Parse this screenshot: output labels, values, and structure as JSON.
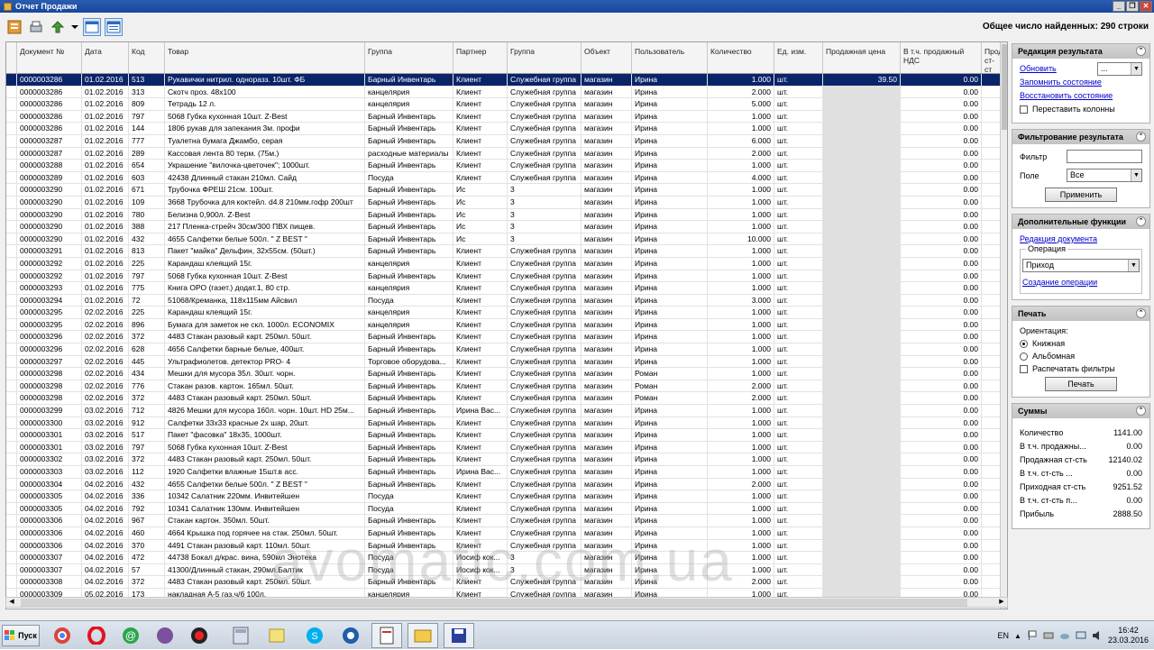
{
  "window": {
    "title": "Отчет Продажи",
    "found_label": "Общее число найденных: 290 строки"
  },
  "toolbar": {
    "icons": [
      "report-icon",
      "print-preview-icon",
      "export-icon",
      "dropdown-arrow-icon",
      "window-icon",
      "layout-icon"
    ]
  },
  "table": {
    "columns": [
      "Документ №",
      "Дата",
      "Код",
      "Товар",
      "Группа",
      "Партнер",
      "Группа",
      "Объект",
      "Пользователь",
      "Количество",
      "Ед. изм.",
      "Продажная цена",
      "В т.ч. продажный НДС",
      "Прод ст-ст"
    ],
    "rows": [
      [
        "0000003286",
        "01.02.2016",
        "513",
        "Рукавички нитрил. одноразз. 10шт. ФБ",
        "Барный Инвентарь",
        "Клиент",
        "Служебная группа",
        "магазин",
        "Ирина",
        "1.000",
        "шт.",
        "39.50",
        "0.00",
        ""
      ],
      [
        "0000003286",
        "01.02.2016",
        "313",
        "Скотч проз. 48х100",
        "канцелярия",
        "Клиент",
        "Служебная группа",
        "магазин",
        "Ирина",
        "2.000",
        "шт.",
        "",
        "0.00",
        ""
      ],
      [
        "0000003286",
        "01.02.2016",
        "809",
        "Тетрадь 12 л.",
        "канцелярия",
        "Клиент",
        "Служебная группа",
        "магазин",
        "Ирина",
        "5.000",
        "шт.",
        "",
        "0.00",
        ""
      ],
      [
        "0000003286",
        "01.02.2016",
        "797",
        "5068 Губка кухонная 10шт.  Z-Best",
        "Барный Инвентарь",
        "Клиент",
        "Служебная группа",
        "магазин",
        "Ирина",
        "1.000",
        "шт.",
        "",
        "0.00",
        ""
      ],
      [
        "0000003286",
        "01.02.2016",
        "144",
        "1806 рукав для запекания  3м. профи",
        "Барный Инвентарь",
        "Клиент",
        "Служебная группа",
        "магазин",
        "Ирина",
        "1.000",
        "шт.",
        "",
        "0.00",
        ""
      ],
      [
        "0000003287",
        "01.02.2016",
        "777",
        "Туалетна бумага Джамбо, серая",
        "Барный Инвентарь",
        "Клиент",
        "Служебная группа",
        "магазин",
        "Ирина",
        "6.000",
        "шт.",
        "",
        "0.00",
        ""
      ],
      [
        "0000003287",
        "01.02.2016",
        "289",
        "Кассовая лента 80 терм. (75м.)",
        "расходные материалы",
        "Клиент",
        "Служебная группа",
        "магазин",
        "Ирина",
        "2.000",
        "шт.",
        "",
        "0.00",
        ""
      ],
      [
        "0000003288",
        "01.02.2016",
        "654",
        "Украшение \"вилочка-цветочек\"; 1000шт.",
        "Барный Инвентарь",
        "Клиент",
        "Служебная группа",
        "магазин",
        "Ирина",
        "1.000",
        "шт.",
        "",
        "0.00",
        ""
      ],
      [
        "0000003289",
        "01.02.2016",
        "603",
        "42438 Длинный стакан 210мл. Сайд",
        "Посуда",
        "Клиент",
        "Служебная группа",
        "магазин",
        "Ирина",
        "4.000",
        "шт.",
        "",
        "0.00",
        ""
      ],
      [
        "0000003290",
        "01.02.2016",
        "671",
        "Трубочка ФРЕШ 21см.  100шт.",
        "Барный Инвентарь",
        "Ис",
        "3",
        "магазин",
        "Ирина",
        "1.000",
        "шт.",
        "",
        "0.00",
        ""
      ],
      [
        "0000003290",
        "01.02.2016",
        "109",
        "3668 Трубочка для коктейл. d4.8 210мм.гофр 200шт",
        "Барный Инвентарь",
        "Ис",
        "3",
        "магазин",
        "Ирина",
        "1.000",
        "шт.",
        "",
        "0.00",
        ""
      ],
      [
        "0000003290",
        "01.02.2016",
        "780",
        "Белизна 0,900л. Z-Best",
        "Барный Инвентарь",
        "Ис",
        "3",
        "магазин",
        "Ирина",
        "1.000",
        "шт.",
        "",
        "0.00",
        ""
      ],
      [
        "0000003290",
        "01.02.2016",
        "388",
        "217 Пленка-стрейч 30см/300 ПВХ пищев.",
        "Барный Инвентарь",
        "Ис",
        "3",
        "магазин",
        "Ирина",
        "1.000",
        "шт.",
        "",
        "0.00",
        ""
      ],
      [
        "0000003290",
        "01.02.2016",
        "432",
        "4655 Салфетки белые 500л. \" Z BEST \"",
        "Барный Инвентарь",
        "Ис",
        "3",
        "магазин",
        "Ирина",
        "10.000",
        "шт.",
        "",
        "0.00",
        ""
      ],
      [
        "0000003291",
        "01.02.2016",
        "813",
        "Пакет \"майка\" Дельфин, 32х55см.  (50шт.)",
        "Барный Инвентарь",
        "Клиент",
        "Служебная группа",
        "магазин",
        "Ирина",
        "1.000",
        "шт.",
        "",
        "0.00",
        ""
      ],
      [
        "0000003292",
        "01.02.2016",
        "225",
        "Карандаш клеящий 15г.",
        "канцелярия",
        "Клиент",
        "Служебная группа",
        "магазин",
        "Ирина",
        "1.000",
        "шт.",
        "",
        "0.00",
        ""
      ],
      [
        "0000003292",
        "01.02.2016",
        "797",
        "5068 Губка кухонная 10шт.  Z-Best",
        "Барный Инвентарь",
        "Клиент",
        "Служебная группа",
        "магазин",
        "Ирина",
        "1.000",
        "шт.",
        "",
        "0.00",
        ""
      ],
      [
        "0000003293",
        "01.02.2016",
        "775",
        "Книга ОРО (газет.) додат.1,  80 стр.",
        "канцелярия",
        "Клиент",
        "Служебная группа",
        "магазин",
        "Ирина",
        "1.000",
        "шт.",
        "",
        "0.00",
        ""
      ],
      [
        "0000003294",
        "01.02.2016",
        "72",
        "51068/Креманка, 118х115мм Айсвил",
        "Посуда",
        "Клиент",
        "Служебная группа",
        "магазин",
        "Ирина",
        "3.000",
        "шт.",
        "",
        "0.00",
        ""
      ],
      [
        "0000003295",
        "02.02.2016",
        "225",
        "Карандаш клеящий 15г.",
        "канцелярия",
        "Клиент",
        "Служебная группа",
        "магазин",
        "Ирина",
        "1.000",
        "шт.",
        "",
        "0.00",
        ""
      ],
      [
        "0000003295",
        "02.02.2016",
        "896",
        "Бумага для заметок не скл. 1000л. ECONOMIX",
        "канцелярия",
        "Клиент",
        "Служебная группа",
        "магазин",
        "Ирина",
        "1.000",
        "шт.",
        "",
        "0.00",
        ""
      ],
      [
        "0000003296",
        "02.02.2016",
        "372",
        "4483 Стакан разовый карт.   250мл. 50шт.",
        "Барный Инвентарь",
        "Клиент",
        "Служебная группа",
        "магазин",
        "Ирина",
        "1.000",
        "шт.",
        "",
        "0.00",
        ""
      ],
      [
        "0000003296",
        "02.02.2016",
        "628",
        "4656 Салфетки барные белые, 400шт.",
        "Барный Инвентарь",
        "Клиент",
        "Служебная группа",
        "магазин",
        "Ирина",
        "1.000",
        "шт.",
        "",
        "0.00",
        ""
      ],
      [
        "0000003297",
        "02.02.2016",
        "445",
        "Ультрафиолетов. детектор PRO- 4",
        "Торговое оборудова...",
        "Клиент",
        "Служебная группа",
        "магазин",
        "Ирина",
        "1.000",
        "шт.",
        "",
        "0.00",
        ""
      ],
      [
        "0000003298",
        "02.02.2016",
        "434",
        "Мешки для мусора 35л. 30шт. чорн.",
        "Барный Инвентарь",
        "Клиент",
        "Служебная группа",
        "магазин",
        "Роман",
        "1.000",
        "шт.",
        "",
        "0.00",
        ""
      ],
      [
        "0000003298",
        "02.02.2016",
        "776",
        "Стакан разов. картон.  165мл.  50шт.",
        "Барный Инвентарь",
        "Клиент",
        "Служебная группа",
        "магазин",
        "Роман",
        "2.000",
        "шт.",
        "",
        "0.00",
        ""
      ],
      [
        "0000003298",
        "02.02.2016",
        "372",
        "4483 Стакан разовый карт.   250мл. 50шт.",
        "Барный Инвентарь",
        "Клиент",
        "Служебная группа",
        "магазин",
        "Роман",
        "2.000",
        "шт.",
        "",
        "0.00",
        ""
      ],
      [
        "0000003299",
        "03.02.2016",
        "712",
        "4826 Мешки для мусора 160л. чорн.  10шт. HD 25м...",
        "Барный Инвентарь",
        "Ирина Вас...",
        "Служебная группа",
        "магазин",
        "Ирина",
        "1.000",
        "шт.",
        "",
        "0.00",
        ""
      ],
      [
        "0000003300",
        "03.02.2016",
        "912",
        "Салфетки 33х33 красные 2х шар, 20шт.",
        "Барный Инвентарь",
        "Клиент",
        "Служебная группа",
        "магазин",
        "Ирина",
        "1.000",
        "шт.",
        "",
        "0.00",
        ""
      ],
      [
        "0000003301",
        "03.02.2016",
        "517",
        "Пакет \"фасовка\" 18х35,  1000шт.",
        "Барный Инвентарь",
        "Клиент",
        "Служебная группа",
        "магазин",
        "Ирина",
        "1.000",
        "шт.",
        "",
        "0.00",
        ""
      ],
      [
        "0000003301",
        "03.02.2016",
        "797",
        "5068 Губка кухонная 10шт.  Z-Best",
        "Барный Инвентарь",
        "Клиент",
        "Служебная группа",
        "магазин",
        "Ирина",
        "1.000",
        "шт.",
        "",
        "0.00",
        ""
      ],
      [
        "0000003302",
        "03.02.2016",
        "372",
        "4483 Стакан разовый карт.   250мл. 50шт.",
        "Барный Инвентарь",
        "Клиент",
        "Служебная группа",
        "магазин",
        "Ирина",
        "1.000",
        "шт.",
        "",
        "0.00",
        ""
      ],
      [
        "0000003303",
        "03.02.2016",
        "112",
        "1920 Салфетки влажные 15шт.в асс.",
        "Барный Инвентарь",
        "Ирина Вас...",
        "Служебная группа",
        "магазин",
        "Ирина",
        "1.000",
        "шт.",
        "",
        "0.00",
        ""
      ],
      [
        "0000003304",
        "04.02.2016",
        "432",
        "4655 Салфетки белые 500л. \" Z BEST \"",
        "Барный Инвентарь",
        "Клиент",
        "Служебная группа",
        "магазин",
        "Ирина",
        "2.000",
        "шт.",
        "",
        "0.00",
        ""
      ],
      [
        "0000003305",
        "04.02.2016",
        "336",
        "10342 Салатник 220мм. Инвитейшен",
        "Посуда",
        "Клиент",
        "Служебная группа",
        "магазин",
        "Ирина",
        "1.000",
        "шт.",
        "",
        "0.00",
        ""
      ],
      [
        "0000003305",
        "04.02.2016",
        "792",
        "10341 Салатник 130мм.  Инвитейшен",
        "Посуда",
        "Клиент",
        "Служебная группа",
        "магазин",
        "Ирина",
        "1.000",
        "шт.",
        "",
        "0.00",
        ""
      ],
      [
        "0000003306",
        "04.02.2016",
        "967",
        "Стакан картон. 350мл.  50шт.",
        "Барный Инвентарь",
        "Клиент",
        "Служебная группа",
        "магазин",
        "Ирина",
        "1.000",
        "шт.",
        "",
        "0.00",
        ""
      ],
      [
        "0000003306",
        "04.02.2016",
        "460",
        "4664 Крышка под горячее на стак. 250мл. 50шт.",
        "Барный Инвентарь",
        "Клиент",
        "Служебная группа",
        "магазин",
        "Ирина",
        "1.000",
        "шт.",
        "",
        "0.00",
        ""
      ],
      [
        "0000003306",
        "04.02.2016",
        "370",
        "4491 Стакан разовый карт. 110мл. 50шт.",
        "Барный Инвентарь",
        "Клиент",
        "Служебная группа",
        "магазин",
        "Ирина",
        "1.000",
        "шт.",
        "",
        "0.00",
        ""
      ],
      [
        "0000003307",
        "04.02.2016",
        "472",
        "44738 Бокал д/крас. вина, 590мл Энотека",
        "Посуда",
        "Иосиф кок...",
        "3",
        "магазин",
        "Ирина",
        "1.000",
        "шт.",
        "",
        "0.00",
        ""
      ],
      [
        "0000003307",
        "04.02.2016",
        "57",
        "41300/Длинный стакан, 290мл.Балтик",
        "Посуда",
        "Иосиф кок...",
        "3",
        "магазин",
        "Ирина",
        "1.000",
        "шт.",
        "",
        "0.00",
        ""
      ],
      [
        "0000003308",
        "04.02.2016",
        "372",
        "4483 Стакан разовый карт.   250мл. 50шт.",
        "Барный Инвентарь",
        "Клиент",
        "Служебная группа",
        "магазин",
        "Ирина",
        "2.000",
        "шт.",
        "",
        "0.00",
        ""
      ],
      [
        "0000003309",
        "05.02.2016",
        "173",
        "накладная А-5 газ.ч/б 100л.",
        "канцелярия",
        "Клиент",
        "Служебная группа",
        "магазин",
        "Ирина",
        "1.000",
        "шт.",
        "",
        "0.00",
        ""
      ]
    ]
  },
  "sidebar": {
    "edit_panel": {
      "title": "Редакция результата",
      "refresh_link": "Обновить",
      "refresh_select": "...",
      "save_state_link": "Запомнить состояние",
      "restore_state_link": "Восстановить состояние",
      "rearrange_columns_label": "Переставить колонны"
    },
    "filter_panel": {
      "title": "Фильтрование результата",
      "filter_label": "Фильтр",
      "filter_value": "",
      "field_label": "Поле",
      "field_value": "Все",
      "apply_button": "Применить"
    },
    "functions_panel": {
      "title": "Дополнительные функции",
      "edit_document_link": "Редакция документа",
      "operation_label": "Операция",
      "operation_value": "Приход",
      "create_operation_link": "Создание операции"
    },
    "print_panel": {
      "title": "Печать",
      "orientation_label": "Ориентация:",
      "portrait_label": "Книжная",
      "landscape_label": "Альбомная",
      "print_filters_label": "Распечатать фильтры",
      "print_button": "Печать"
    },
    "sums_panel": {
      "title": "Суммы",
      "rows": [
        {
          "label": "Количество",
          "value": "1141.00"
        },
        {
          "label": "В т.ч. продажны...",
          "value": "0.00"
        },
        {
          "label": "Продажная ст-сть",
          "value": "12140.02"
        },
        {
          "label": "В т.ч. ст-сть ...",
          "value": "0.00"
        },
        {
          "label": "Приходная ст-сть",
          "value": "9251.52"
        },
        {
          "label": "В т.ч. ст-сть п...",
          "value": "0.00"
        },
        {
          "label": "Прибыль",
          "value": "2888.50"
        }
      ]
    }
  },
  "taskbar": {
    "start_label": "Пуск",
    "lang": "EN",
    "time": "16:42",
    "date": "23.03.2016"
  },
  "watermark": "avomatic.com.ua"
}
